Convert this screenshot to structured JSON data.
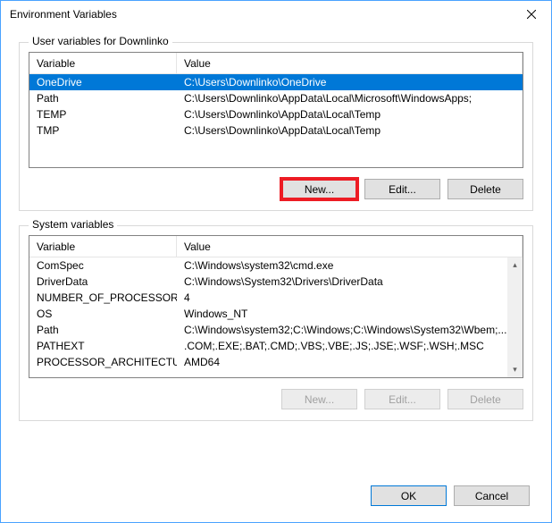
{
  "window": {
    "title": "Environment Variables"
  },
  "userGroup": {
    "label": "User variables for Downlinko",
    "columns": {
      "variable": "Variable",
      "value": "Value"
    },
    "rows": [
      {
        "variable": "OneDrive",
        "value": "C:\\Users\\Downlinko\\OneDrive",
        "selected": true
      },
      {
        "variable": "Path",
        "value": "C:\\Users\\Downlinko\\AppData\\Local\\Microsoft\\WindowsApps;",
        "selected": false
      },
      {
        "variable": "TEMP",
        "value": "C:\\Users\\Downlinko\\AppData\\Local\\Temp",
        "selected": false
      },
      {
        "variable": "TMP",
        "value": "C:\\Users\\Downlinko\\AppData\\Local\\Temp",
        "selected": false
      }
    ],
    "buttons": {
      "new": "New...",
      "edit": "Edit...",
      "delete": "Delete"
    }
  },
  "sysGroup": {
    "label": "System variables",
    "columns": {
      "variable": "Variable",
      "value": "Value"
    },
    "rows": [
      {
        "variable": "ComSpec",
        "value": "C:\\Windows\\system32\\cmd.exe"
      },
      {
        "variable": "DriverData",
        "value": "C:\\Windows\\System32\\Drivers\\DriverData"
      },
      {
        "variable": "NUMBER_OF_PROCESSORS",
        "value": "4"
      },
      {
        "variable": "OS",
        "value": "Windows_NT"
      },
      {
        "variable": "Path",
        "value": "C:\\Windows\\system32;C:\\Windows;C:\\Windows\\System32\\Wbem;..."
      },
      {
        "variable": "PATHEXT",
        "value": ".COM;.EXE;.BAT;.CMD;.VBS;.VBE;.JS;.JSE;.WSF;.WSH;.MSC"
      },
      {
        "variable": "PROCESSOR_ARCHITECTURE",
        "value": "AMD64"
      }
    ],
    "buttons": {
      "new": "New...",
      "edit": "Edit...",
      "delete": "Delete"
    }
  },
  "footer": {
    "ok": "OK",
    "cancel": "Cancel"
  }
}
